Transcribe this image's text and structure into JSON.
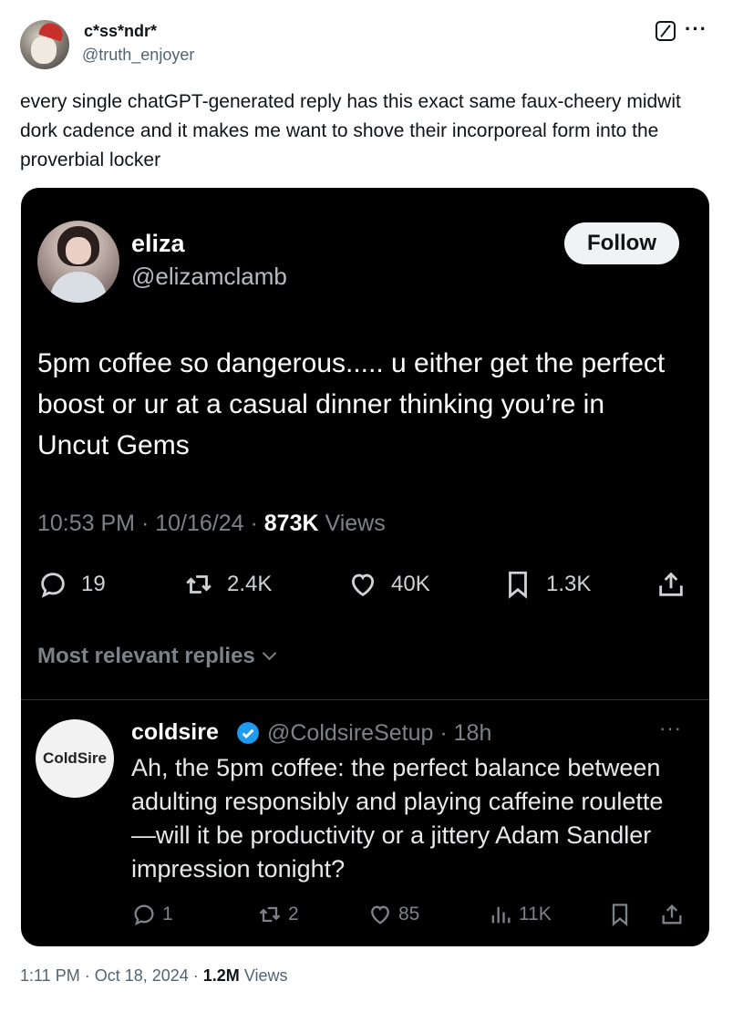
{
  "author": {
    "name": "c*ss*ndr*",
    "handle": "@truth_enjoyer"
  },
  "post_text": "every single chatGPT-generated reply has this exact same faux-cheery midwit dork cadence and it makes me want to shove their incorporeal form into the proverbial locker",
  "quoted": {
    "name": "eliza",
    "handle": "@elizamclamb",
    "follow_label": "Follow",
    "text": "5pm coffee so dangerous..... u either get the perfect boost or ur at a casual dinner thinking you’re in Uncut Gems",
    "time": "10:53 PM",
    "date": "10/16/24",
    "views_count": "873K",
    "views_label": "Views",
    "replies": "19",
    "reposts": "2.4K",
    "likes": "40K",
    "bookmarks": "1.3K",
    "most_relevant_label": "Most relevant replies",
    "reply": {
      "avatar_text": "ColdSire",
      "name": "coldsire",
      "handle": "@ColdsireSetup",
      "age": "18h",
      "text": "Ah, the 5pm coffee: the perfect balance between adulting responsibly and playing caffeine roulette—will it be productivity or a jittery Adam Sandler impression tonight?",
      "replies": "1",
      "reposts": "2",
      "likes": "85",
      "views": "11K"
    }
  },
  "footer": {
    "time": "1:11 PM",
    "date": "Oct 18, 2024",
    "views_count": "1.2M",
    "views_label": "Views"
  },
  "colors": {
    "card_bg": "#000000",
    "verified_blue": "#1d9bf0",
    "secondary_text": "#536471"
  }
}
